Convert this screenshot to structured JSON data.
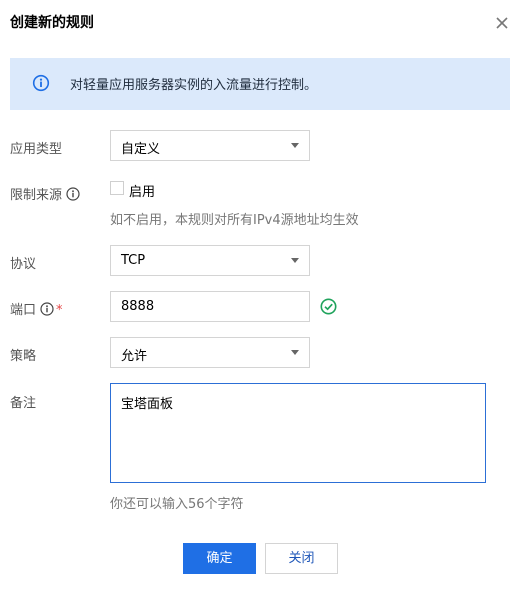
{
  "dialog": {
    "title": "创建新的规则"
  },
  "banner": {
    "text": "对轻量应用服务器实例的入流量进行控制。"
  },
  "form": {
    "app_type": {
      "label": "应用类型",
      "value": "自定义"
    },
    "source_limit": {
      "label": "限制来源",
      "checkbox_label": "启用",
      "checked": false,
      "hint": "如不启用，本规则对所有IPv4源地址均生效"
    },
    "protocol": {
      "label": "协议",
      "value": "TCP"
    },
    "port": {
      "label": "端口",
      "required_mark": "*",
      "value": "8888"
    },
    "policy": {
      "label": "策略",
      "value": "允许"
    },
    "remark": {
      "label": "备注",
      "value": "宝塔面板",
      "hint": "你还可以输入56个字符"
    }
  },
  "actions": {
    "confirm_label": "确定",
    "close_label": "关闭"
  },
  "colors": {
    "primary": "#1f6fe5",
    "banner_bg": "#dbe9fb",
    "success": "#1fa35c",
    "required": "#e54545"
  }
}
